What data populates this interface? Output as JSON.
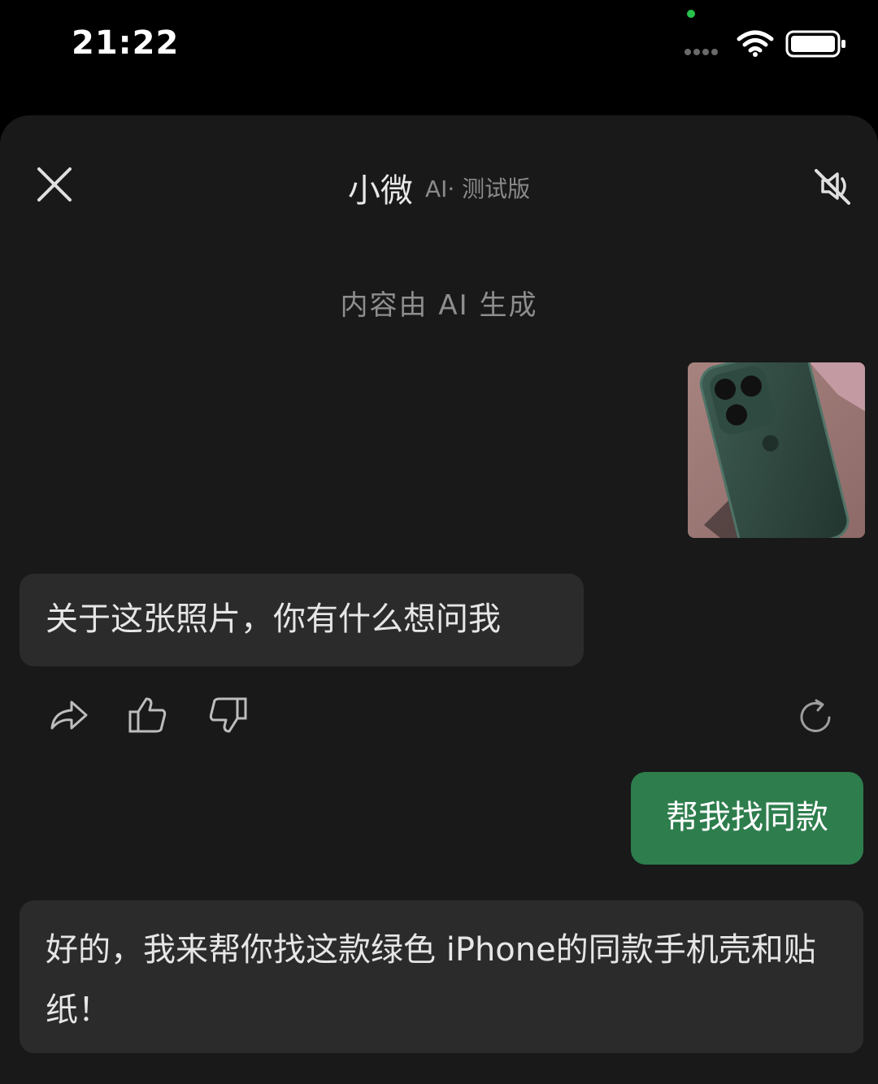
{
  "status_bar": {
    "time": "21:22",
    "camera_dot_color": "#27c24c",
    "icons": [
      "signal-dots-icon",
      "wifi-icon",
      "battery-icon"
    ]
  },
  "header": {
    "title": "小微",
    "subtitle": "AI· 测试版",
    "close_icon": "close-icon",
    "mute_icon": "mute-icon"
  },
  "disclaimer": "内容由 AI 生成",
  "messages": [
    {
      "role": "user",
      "type": "image",
      "description_icon": "photo-thumbnail"
    },
    {
      "role": "assistant",
      "text": "关于这张照片，你有什么想问我"
    },
    {
      "role": "user",
      "text": "帮我找同款"
    },
    {
      "role": "assistant",
      "text": "好的，我来帮你找这款绿色 iPhone的同款手机壳和贴纸！"
    }
  ],
  "actions": [
    "share-icon",
    "thumbs-up-icon",
    "thumbs-down-icon",
    "refresh-icon"
  ],
  "colors": {
    "background": "#000000",
    "sheet": "#191919",
    "assistant_bubble": "#2b2b2b",
    "user_bubble": "#2e7d4d",
    "text": "#e6e6e6",
    "muted_text": "#8e8e8e"
  }
}
